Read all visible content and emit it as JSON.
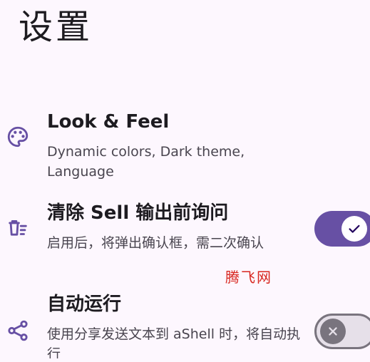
{
  "page": {
    "title": "设置"
  },
  "settings": {
    "items": [
      {
        "icon": "palette-icon",
        "title": "Look & Feel",
        "summary": "Dynamic colors, Dark theme, Language"
      },
      {
        "icon": "clear-list-icon",
        "title": "清除 Sell 输出前询问",
        "summary": "启用后，将弹出确认框，需二次确认",
        "toggle": "on"
      },
      {
        "icon": "share-icon",
        "title": "自动运行",
        "summary": "使用分享发送文本到 aShell 时，将自动执行",
        "toggle": "off"
      }
    ]
  },
  "watermark": {
    "text": "腾飞网"
  },
  "colors": {
    "background": "#fdf7fe",
    "accent": "#6750a4",
    "icon_tint": "#6750a4",
    "switch_off_track": "#e6e0e9",
    "switch_off_outline": "#79747e",
    "watermark": "#d8261f"
  }
}
